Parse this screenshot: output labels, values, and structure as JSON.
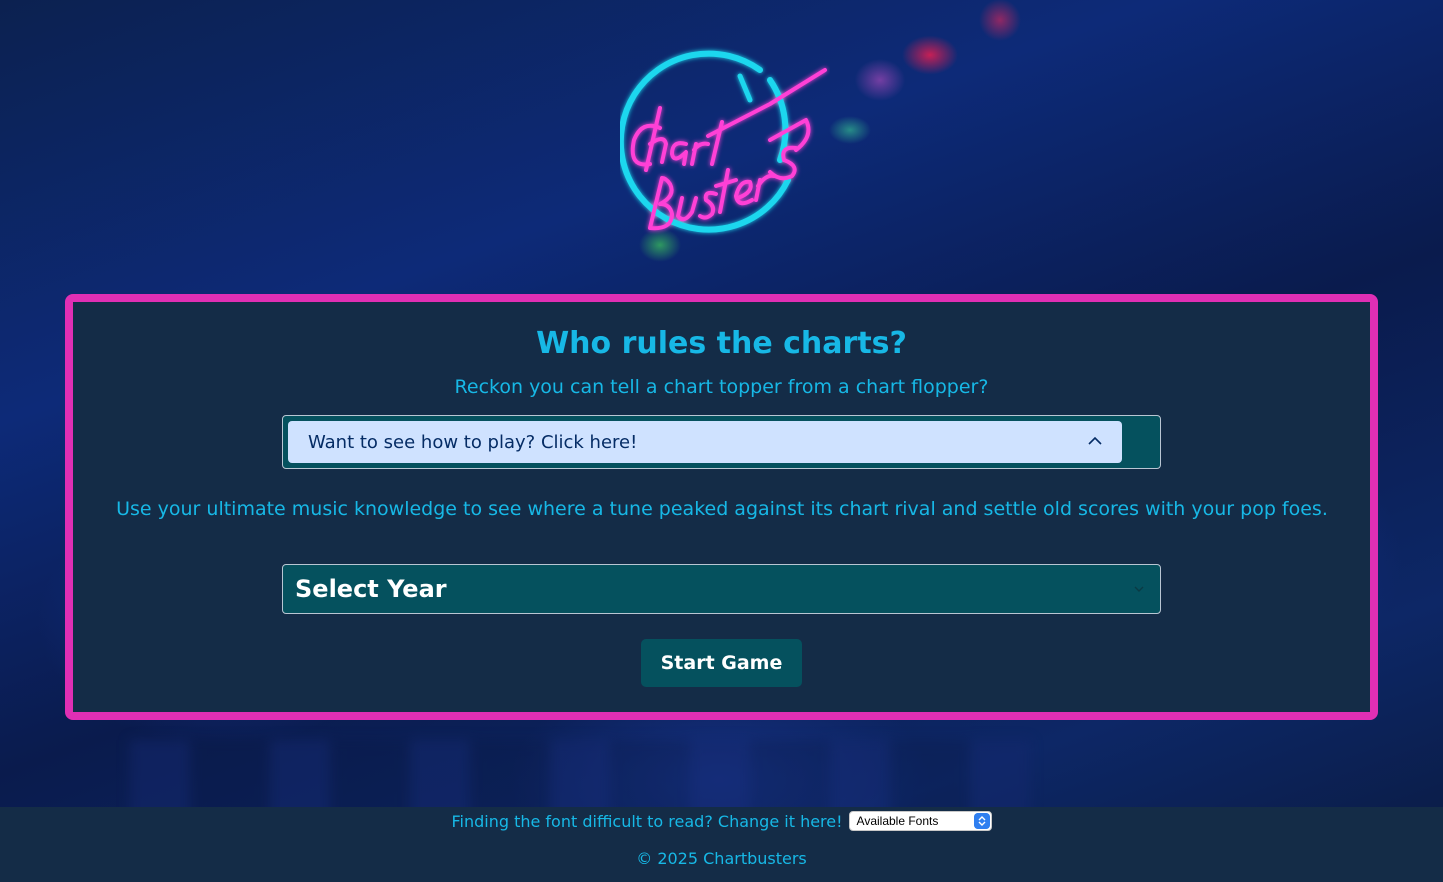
{
  "colors": {
    "accent_text": "#17b8e6",
    "card_border": "#e02fb4",
    "card_background": "#142c47",
    "control_background": "#05515e",
    "howto_button_background": "#cfe2ff",
    "logo_circle": "#1fd7ee",
    "logo_text": "#ff3fd6"
  },
  "logo": {
    "icon": "chartbusters-neon-logo"
  },
  "card": {
    "title": "Who rules the charts?",
    "subtitle": "Reckon you can tell a chart topper from a chart flopper?",
    "howto_label": "Want to see how to play? Click here!",
    "howto_icon": "chevron-up-icon",
    "description": "Use your ultimate music knowledge to see where a tune peaked against its chart rival and settle old scores with your pop foes.",
    "year_select": {
      "selected": "Select Year",
      "icon": "chevron-down-icon"
    },
    "start_label": "Start Game"
  },
  "footer": {
    "font_prompt": "Finding the font difficult to read? Change it here!",
    "font_select": {
      "selected": "Available Fonts",
      "icon": "select-arrows-icon"
    },
    "copyright": "© 2025 Chartbusters"
  }
}
